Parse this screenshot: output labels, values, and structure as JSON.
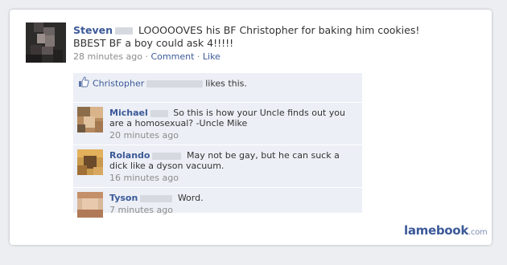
{
  "post": {
    "author": "Steven",
    "text": "LOOOOOVES his BF Christopher for baking him cookies! BBEST BF a boy could ask 4!!!!!",
    "time": "28 minutes ago",
    "separator": "·",
    "comment_label": "Comment",
    "like_label": "Like"
  },
  "likes": {
    "name": "Christopher",
    "suffix": "likes this."
  },
  "comments": [
    {
      "author": "Michael",
      "text": "So this is how your Uncle finds out you are a homosexual? -Uncle Mike",
      "time": "20 minutes ago"
    },
    {
      "author": "Rolando",
      "text": "May not be gay, but he can suck a dick like a dyson vacuum.",
      "time": "16 minutes ago"
    },
    {
      "author": "Tyson",
      "text": "Word.",
      "time": "7 minutes ago"
    }
  ],
  "watermark": {
    "brand": "lamebook",
    "tld": ".com"
  },
  "colors": {
    "link": "#3b5998",
    "comment_bg": "#eceff5",
    "meta": "#8c8c8c"
  },
  "icons": {
    "like": "thumbs-up-icon"
  }
}
